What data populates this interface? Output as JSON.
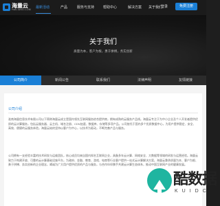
{
  "header": {
    "logo_name": "海量云",
    "logo_sub": "HAILIANG.COM",
    "nav": [
      {
        "label": "最新活动",
        "active": true
      },
      {
        "label": "产品",
        "active": false
      },
      {
        "label": "服务与支持",
        "active": false
      },
      {
        "label": "帮助中心",
        "active": false
      },
      {
        "label": "解决方案",
        "active": false
      },
      {
        "label": "关于我们",
        "active": false
      }
    ],
    "login_label": "登录",
    "register_label": "免费注册"
  },
  "hero": {
    "title": "关于我们",
    "subtitle": "质量为本，客户为根，勇于拼搏，务实创新"
  },
  "tabs": [
    {
      "label": "公司简介",
      "active": true
    },
    {
      "label": "新闻公告",
      "active": false
    },
    {
      "label": "联系我们",
      "active": false
    },
    {
      "label": "法律声明",
      "active": false
    },
    {
      "label": "友情链接",
      "active": false
    }
  ],
  "main": {
    "section_title": "公司介绍",
    "paragraph1": "淮南海量信息技术有限公司以下简称海量云成立是国内领先互联网服务综合提供商，拥有成熟的云服务产品线。海量云专注于为中小企业及个人开发者提供优质的云计算服务，包括云服务器、云主机、域名注册、CDN加速、数据库、存储等多项产品。公司依托于国内多个优质数据中心，为用户提供稳定、安全、高效、便捷的云服务体验。海量云始终坚持以客户为中心，以技术为驱动，不断完善产品与服务。",
    "paragraph2": "公司拥有一支经验丰富的技术研发与运维团队，核心成员均来自国内知名互联网企业，具备多年云计算、网络安全、大数据等领域的研发与运营经验。海量云致力于构建开放、可靠的云计算基础设施平台，为政府、金融、教育、游戏、电商等行业客户提供一站式云计算解决方案。海量云秉承质量为本、客户为根、勇于拼搏、务实创新的企业理念，竭诚为广大用户提供优质的产品与服务，与合作伙伴携手共建云计算生态体系，推动中国互联网产业的健康发展。"
  },
  "watermark": {
    "text": "酷数据",
    "sub": "KUIDC"
  },
  "colors": {
    "accent": "#1a7fd6",
    "watermark_green": "#1fb5a0"
  }
}
